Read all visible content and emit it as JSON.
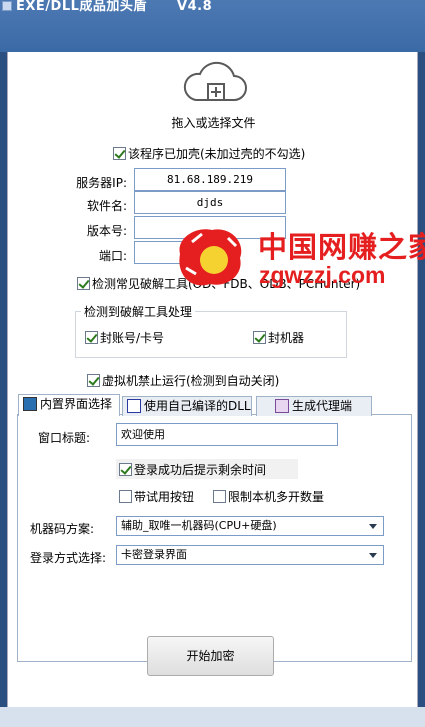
{
  "window": {
    "title": "EXE/DLL成品加头盾      V4.8"
  },
  "drop": {
    "label": "拖入或选择文件",
    "icon": "cloud-upload-icon"
  },
  "shell_check": {
    "label": "该程序已加壳(未加过壳的不勾选)",
    "checked": true
  },
  "fields": {
    "server_ip": {
      "label": "服务器IP:",
      "value": "81.68.189.219"
    },
    "software_name": {
      "label": "软件名:",
      "value": "djds"
    },
    "version": {
      "label": "版本号:",
      "value": ""
    },
    "port": {
      "label": "端口:",
      "value": ""
    }
  },
  "crack_check": {
    "label": "检测常见破解工具(OD、FDB、ODB、PCHunter)",
    "checked": true
  },
  "crack_group": {
    "title": "检测到破解工具处理",
    "ban_account": {
      "label": "封账号/卡号",
      "checked": true
    },
    "ban_machine": {
      "label": "封机器",
      "checked": true
    }
  },
  "vm_check": {
    "label": "虚拟机禁止运行(检测到自动关闭)",
    "checked": true
  },
  "tabs": [
    {
      "label": "内置界面选择",
      "icon": "builtin-ui-icon",
      "active": true
    },
    {
      "label": "使用自己编译的DLL",
      "icon": "dll-icon",
      "active": false
    },
    {
      "label": "生成代理端",
      "icon": "proxy-icon",
      "active": false
    }
  ],
  "panel": {
    "window_title": {
      "label": "窗口标题:",
      "value": "欢迎使用"
    },
    "remain_time": {
      "label": "登录成功后提示剩余时间",
      "checked": true
    },
    "trial_button": {
      "label": "带试用按钮",
      "checked": false
    },
    "limit_multi": {
      "label": "限制本机多开数量",
      "checked": false
    },
    "machine_code": {
      "label": "机器码方案:",
      "value": "辅助_取唯一机器码(CPU+硬盘)"
    },
    "login_mode": {
      "label": "登录方式选择:",
      "value": "卡密登录界面"
    }
  },
  "start_button": {
    "label": "开始加密"
  },
  "watermark": {
    "line1": "中国网赚之家",
    "line2": "zgwzzj.com"
  },
  "colors": {
    "title_bar": "#3a6aa6",
    "watermark_red": "#e51f1f",
    "check_green": "#2d7a1e"
  }
}
